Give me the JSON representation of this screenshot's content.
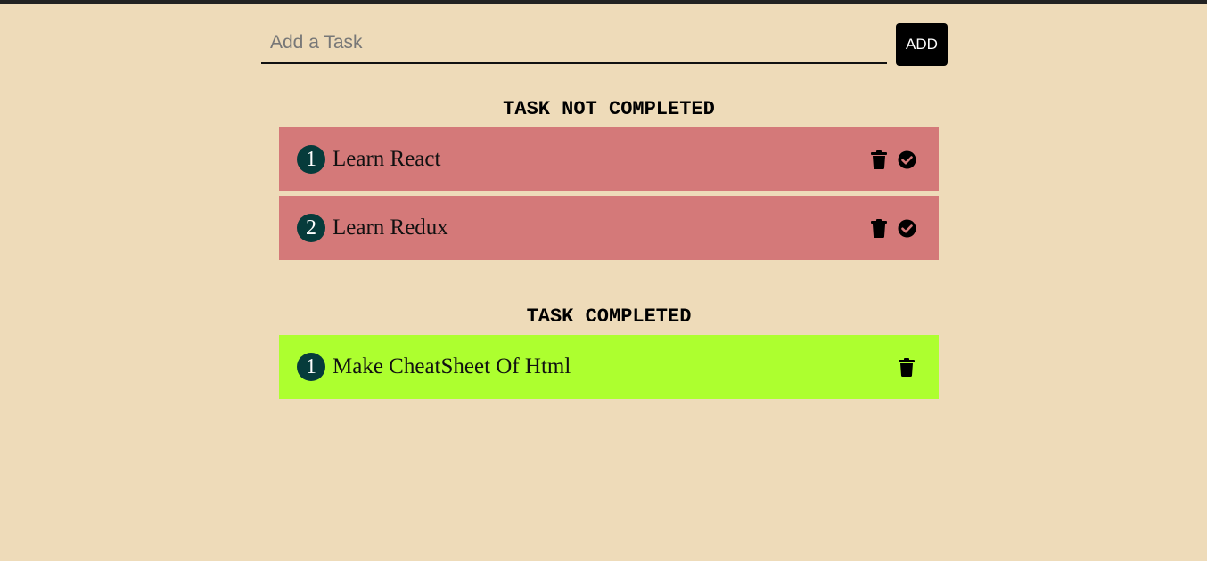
{
  "input": {
    "placeholder": "Add a Task",
    "value": ""
  },
  "add_button": {
    "label": "ADD"
  },
  "sections": {
    "not_completed": {
      "heading": "TASK NOT COMPLETED",
      "color": "#d47979",
      "tasks": [
        {
          "number": "1",
          "text": "Learn React",
          "icons": [
            "trash-icon",
            "check-circle-icon"
          ]
        },
        {
          "number": "2",
          "text": "Learn Redux",
          "icons": [
            "trash-icon",
            "check-circle-icon"
          ]
        }
      ]
    },
    "completed": {
      "heading": "TASK COMPLETED",
      "color": "#adff2f",
      "tasks": [
        {
          "number": "1",
          "text": "Make CheatSheet Of Html",
          "icons": [
            "trash-icon"
          ]
        }
      ]
    }
  },
  "colors": {
    "background": "#eedbb9",
    "number_badge": "#063b3b",
    "button": "#000000"
  }
}
